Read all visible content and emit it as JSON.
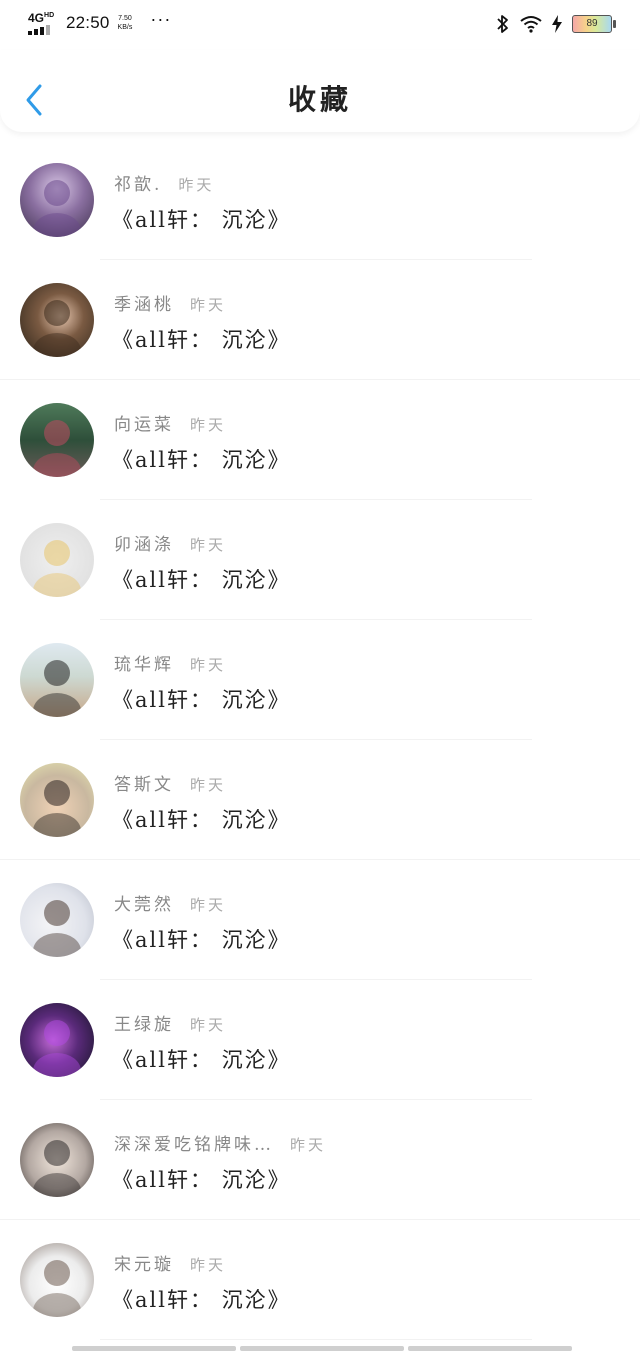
{
  "status_bar": {
    "network": "4G",
    "network_sup": "HD",
    "time": "22:50",
    "speed_value": "7.50",
    "speed_unit": "KB/s",
    "more": "···",
    "battery": "89"
  },
  "header": {
    "title": "收藏"
  },
  "items": [
    {
      "user": "祁歆.",
      "time": "昨天",
      "title": "《all轩： 沉沦》",
      "avatar": {
        "bg": "radial-gradient(circle at 50% 35%, #d9c7e6 0%, #8a6fa0 45%, #3b2e4a 100%)",
        "accent": "#6b4a8c"
      }
    },
    {
      "user": "季涵桃",
      "time": "昨天",
      "title": "《all轩： 沉沦》",
      "avatar": {
        "bg": "radial-gradient(circle at 55% 45%, #e9c9b2 0%, #7a5a42 40%, #2a2218 100%)",
        "accent": "#3b2a1c"
      }
    },
    {
      "user": "向运菜",
      "time": "昨天",
      "title": "《all轩： 沉沦》",
      "avatar": {
        "bg": "linear-gradient(180deg, #4f7a5a 0%, #2e4f3a 50%, #6a5a58 100%)",
        "accent": "#c04a60"
      }
    },
    {
      "user": "卯涵涤",
      "time": "昨天",
      "title": "《all轩： 沉沦》",
      "avatar": {
        "bg": "radial-gradient(circle at 50% 50%, #efefef 0%, #dcdcdc 100%)",
        "accent": "#e8c46a"
      }
    },
    {
      "user": "琉华辉",
      "time": "昨天",
      "title": "《all轩： 沉沦》",
      "avatar": {
        "bg": "linear-gradient(180deg, #dfe9f0 0%, #cdd9d2 45%, #c7a88a 100%)",
        "accent": "#222222"
      }
    },
    {
      "user": "答斯文",
      "time": "昨天",
      "title": "《all轩： 沉沦》",
      "avatar": {
        "bg": "radial-gradient(circle at 50% 60%, #f0d2b6 0%, #c9b8a0 55%, #e6e7b0 100%)",
        "accent": "#2b2320"
      }
    },
    {
      "user": "大莞然",
      "time": "昨天",
      "title": "《all轩： 沉沦》",
      "avatar": {
        "bg": "radial-gradient(circle at 40% 55%, #f4f4f6 0%, #dfe2ea 60%, #b7bcc8 100%)",
        "accent": "#4a3a33"
      }
    },
    {
      "user": "王绿旋",
      "time": "昨天",
      "title": "《all轩： 沉沦》",
      "avatar": {
        "bg": "radial-gradient(circle at 45% 50%, #c46ad8 0%, #5a2a7a 45%, #141424 100%)",
        "accent": "#b04ae0"
      }
    },
    {
      "user": "深深爱吃铭牌味…",
      "time": "昨天",
      "title": "《all轩： 沉沦》",
      "avatar": {
        "bg": "radial-gradient(circle at 50% 50%, #f1e6dc 0%, #b3a8a2 55%, #3a3330 100%)",
        "accent": "#2e2a2a"
      }
    },
    {
      "user": "宋元璇",
      "time": "昨天",
      "title": "《all轩： 沉沦》",
      "avatar": {
        "bg": "radial-gradient(circle at 50% 55%, #ffffff 0%, #ececec 50%, #8c7f78 100%)",
        "accent": "#6b5a4f"
      }
    }
  ]
}
